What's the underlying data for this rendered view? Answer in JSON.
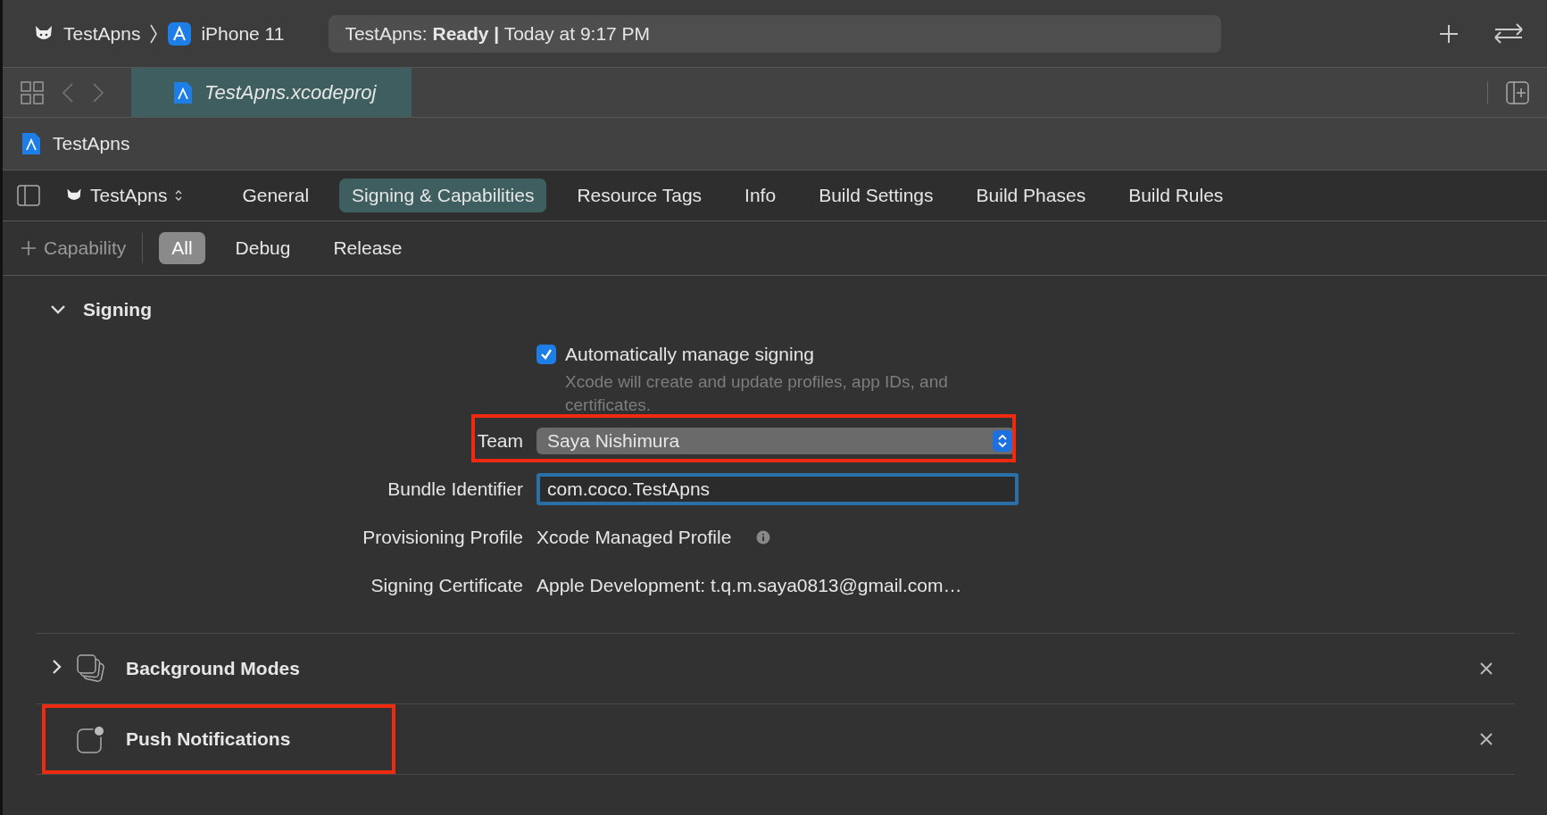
{
  "toolbar": {
    "scheme": "TestApns",
    "destination": "iPhone 11",
    "status": "TestApns: **Ready |** Today at 9:17 PM"
  },
  "file_tabs": [
    {
      "label": "TestApns.xcodeproj",
      "selected": true
    }
  ],
  "breadcrumb": "TestApns",
  "editor": {
    "target": "TestApns",
    "tabs": [
      {
        "label": "General",
        "selected": false
      },
      {
        "label": "Signing & Capabilities",
        "selected": true
      },
      {
        "label": "Resource Tags",
        "selected": false
      },
      {
        "label": "Info",
        "selected": false
      },
      {
        "label": "Build Settings",
        "selected": false
      },
      {
        "label": "Build Phases",
        "selected": false
      },
      {
        "label": "Build Rules",
        "selected": false
      }
    ]
  },
  "filter_bar": {
    "add_label": "Capability",
    "filters": [
      {
        "label": "All",
        "selected": true
      },
      {
        "label": "Debug",
        "selected": false
      },
      {
        "label": "Release",
        "selected": false
      }
    ]
  },
  "signing": {
    "title": "Signing",
    "expanded": true,
    "auto_manage": {
      "label": "Automatically manage signing",
      "checked": true,
      "note": "Xcode will create and update profiles, app IDs, and certificates."
    },
    "fields": [
      {
        "kind": "popup",
        "label": "Team",
        "value": "Saya Nishimura",
        "highlighted": true
      },
      {
        "kind": "text_field",
        "label": "Bundle Identifier",
        "value": "com.coco.TestApns",
        "highlighted": false
      },
      {
        "kind": "info",
        "label": "Provisioning Profile",
        "value": "Xcode Managed Profile",
        "highlighted": false
      },
      {
        "kind": "text",
        "label": "Signing Certificate",
        "value": "Apple Development: t.q.m.saya0813@gmail.com…",
        "highlighted": false
      }
    ]
  },
  "capabilities": [
    {
      "kind": "modes",
      "name": "Background Modes",
      "collapsible": true,
      "highlighted": false
    },
    {
      "kind": "push",
      "name": "Push Notifications",
      "collapsible": false,
      "highlighted": true
    }
  ]
}
